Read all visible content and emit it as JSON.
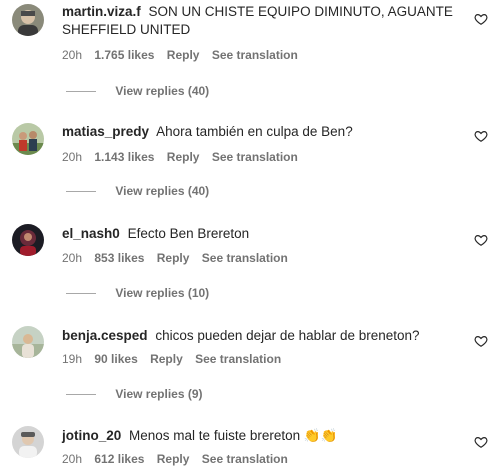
{
  "comments": [
    {
      "username": "martin.viza.f",
      "text": "SON UN CHISTE EQUIPO DIMINUTO, AGUANTE SHEFFIELD UNITED",
      "time": "20h",
      "likes": "1.765 likes",
      "reply_label": "Reply",
      "translate_label": "See translation",
      "view_replies": "View replies (40)"
    },
    {
      "username": "matias_predy",
      "text": "Ahora también en culpa de Ben?",
      "time": "20h",
      "likes": "1.143 likes",
      "reply_label": "Reply",
      "translate_label": "See translation",
      "view_replies": "View replies (40)"
    },
    {
      "username": "el_nash0",
      "text": "Efecto Ben Brereton",
      "time": "20h",
      "likes": "853 likes",
      "reply_label": "Reply",
      "translate_label": "See translation",
      "view_replies": "View replies (10)"
    },
    {
      "username": "benja.cesped",
      "text": "chicos pueden dejar de hablar de breneton?",
      "time": "19h",
      "likes": "90 likes",
      "reply_label": "Reply",
      "translate_label": "See translation",
      "view_replies": "View replies (9)"
    },
    {
      "username": "jotino_20",
      "text": "Menos mal te fuiste brereton 👏👏",
      "time": "20h",
      "likes": "612 likes",
      "reply_label": "Reply",
      "translate_label": "See translation"
    }
  ],
  "icons": {
    "like": "heart-outline-icon",
    "avatar": "user-avatar"
  },
  "colors": {
    "text": "#262626",
    "secondary": "#737373"
  }
}
